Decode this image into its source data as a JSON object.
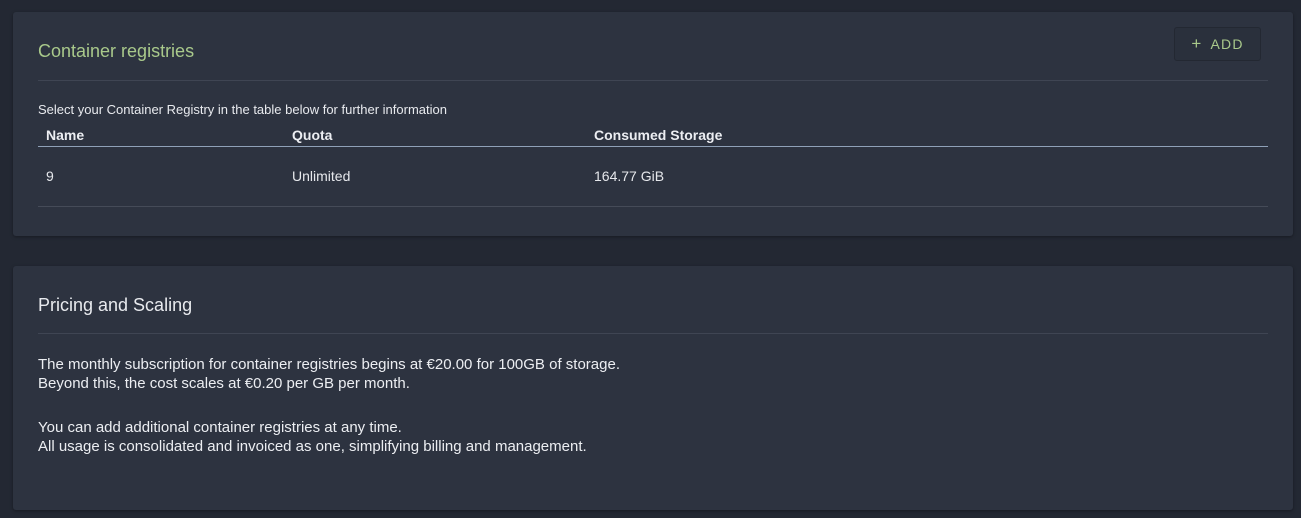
{
  "registries": {
    "title": "Container registries",
    "add_label": "ADD",
    "subtitle": "Select your Container Registry in the table below for further information",
    "columns": [
      "Name",
      "Quota",
      "Consumed Storage"
    ],
    "rows": [
      {
        "name": "9",
        "quota": "Unlimited",
        "consumed_storage": "164.77 GiB"
      }
    ]
  },
  "pricing": {
    "title": "Pricing and Scaling",
    "paragraphs": [
      {
        "lines": [
          "The monthly subscription for container registries begins at €20.00 for 100GB of storage.",
          "Beyond this, the cost scales at €0.20 per GB per month."
        ]
      },
      {
        "lines": [
          "You can add additional container registries at any time.",
          "All usage is consolidated and invoiced as one, simplifying billing and management."
        ]
      }
    ]
  },
  "colors": {
    "accent": "#a9c98b",
    "card_background": "#2d3340",
    "page_background": "#232833"
  },
  "icons": {
    "add": "plus-icon"
  }
}
